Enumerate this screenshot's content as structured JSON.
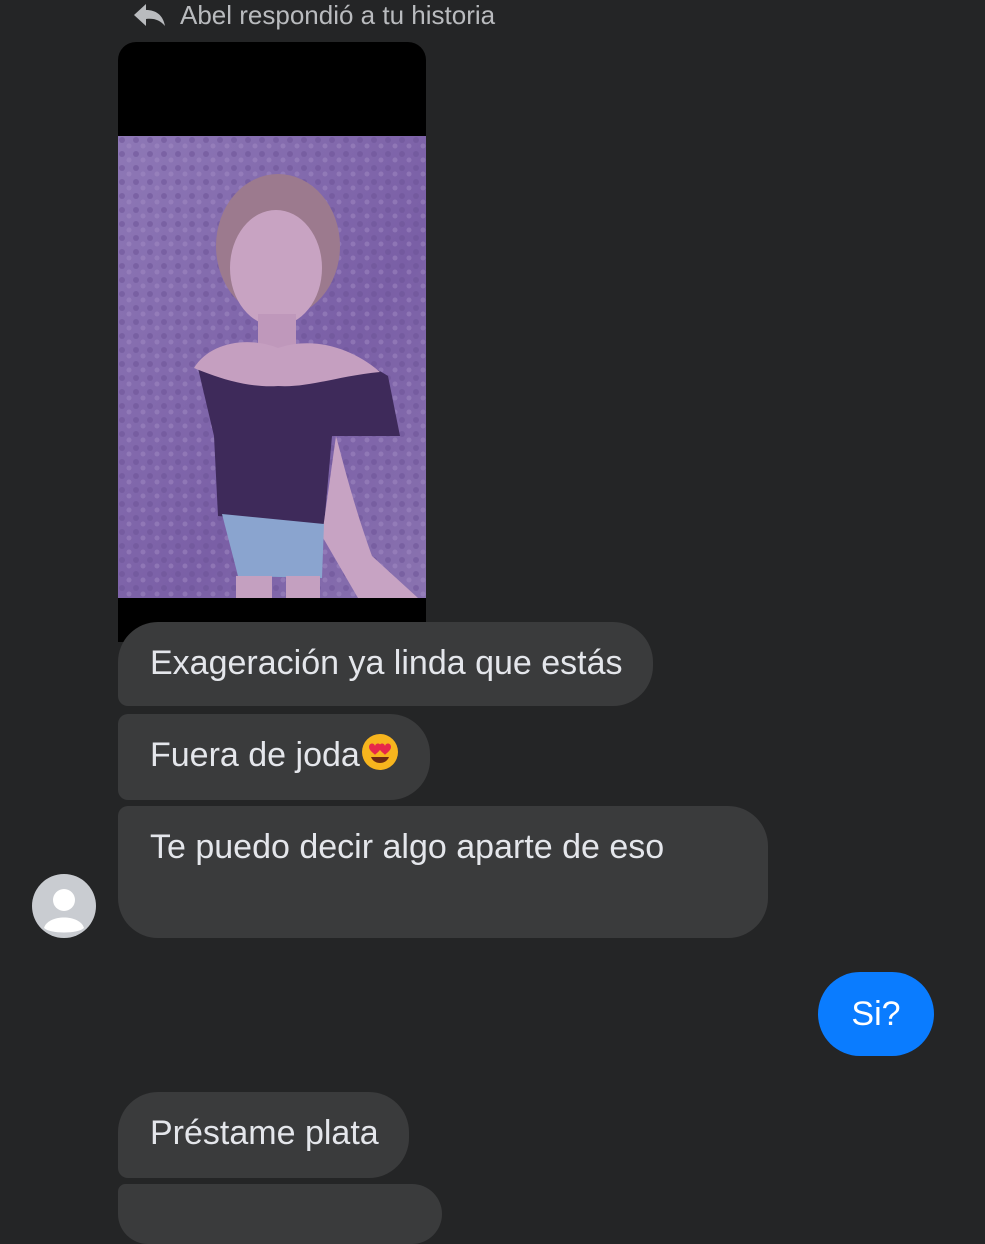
{
  "reply_header": {
    "text": "Abel respondió a tu historia",
    "icon": "reply-arrow-icon"
  },
  "story": {
    "media": "story-photo"
  },
  "messages": {
    "received_1": "Exageración ya linda que estás",
    "received_2": "Fuera de joda",
    "received_2_emoji": "heart-eyes-emoji",
    "received_3": "Te puedo decir algo aparte de eso",
    "sent_1": "Si?",
    "received_4": "Préstame plata"
  },
  "avatar": {
    "icon": "default-avatar-icon"
  },
  "colors": {
    "background": "#242526",
    "received_bubble": "#3a3b3c",
    "sent_bubble": "#0a7cff",
    "text": "#e4e6eb",
    "header_text": "#b9bbbe"
  }
}
